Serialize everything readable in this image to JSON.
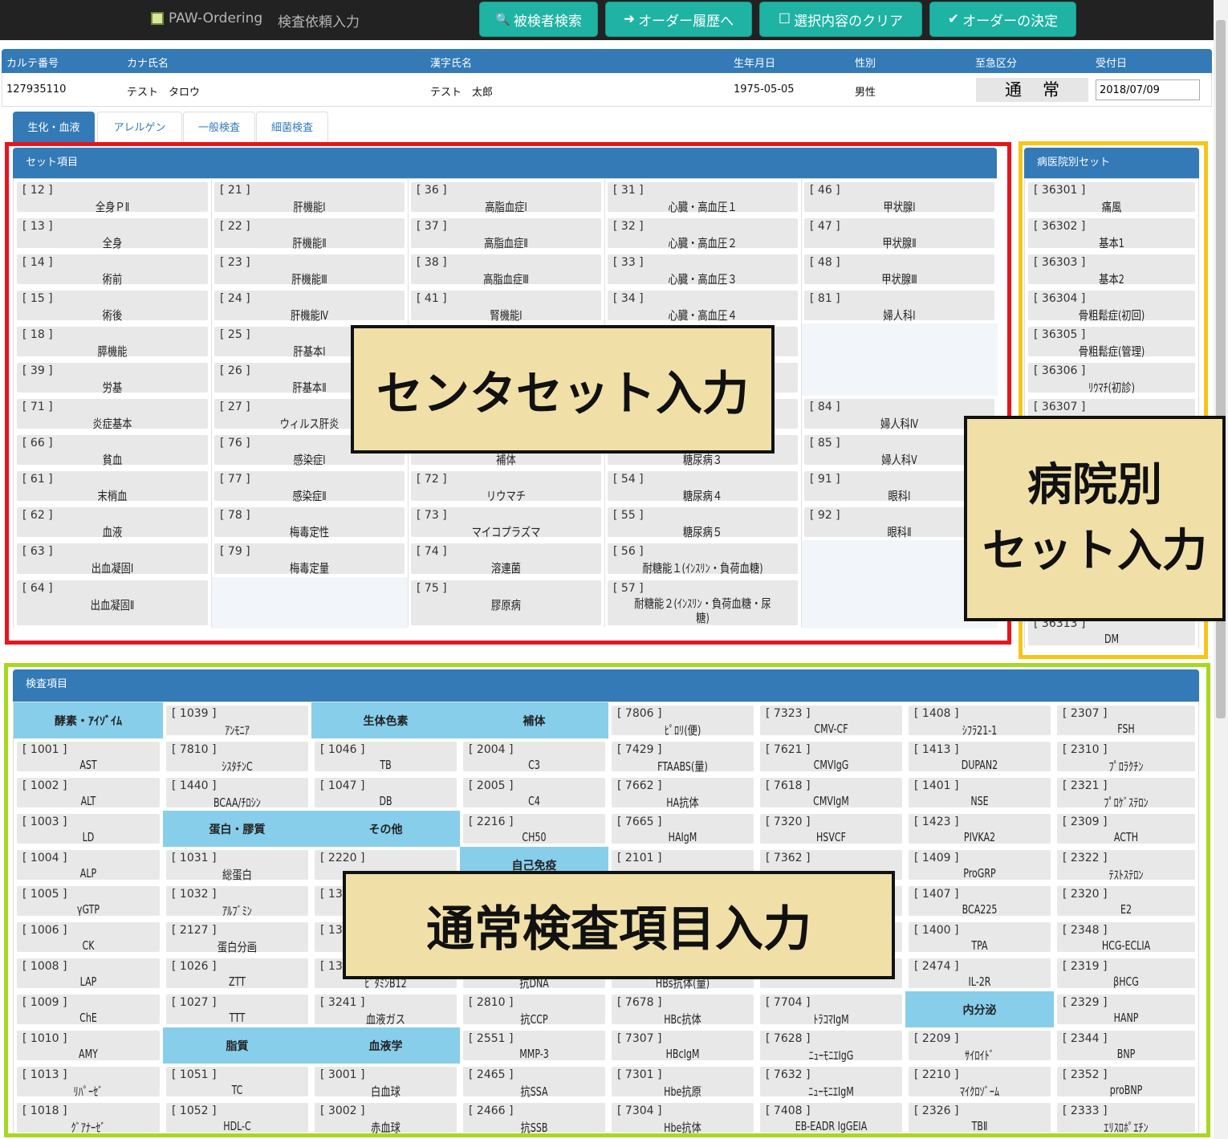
{
  "app": {
    "title": "PAW-Ordering",
    "subtitle": "検査依頼入力"
  },
  "toolbar": [
    {
      "icon": "search-icon",
      "label": "被検者検索",
      "glyph": "🔍"
    },
    {
      "icon": "arrow-right-icon",
      "label": "オーダー履歴へ",
      "glyph": "➜"
    },
    {
      "icon": "checkbox-empty-icon",
      "label": "選択内容のクリア",
      "glyph": "☐"
    },
    {
      "icon": "checkmark-icon",
      "label": "オーダーの決定",
      "glyph": "✔"
    }
  ],
  "patient": {
    "headers": [
      "カルテ番号",
      "カナ氏名",
      "漢字氏名",
      "生年月日",
      "性別",
      "至急区分",
      "受付日"
    ],
    "chart_no": "127935110",
    "kana": "テスト　タロウ",
    "kanji": "テスト　太郎",
    "birth": "1975-05-05",
    "sex": "男性",
    "urgency": "通常",
    "reception_date": "2018/07/09"
  },
  "tabs": [
    "生化・血液",
    "アレルゲン",
    "一般検査",
    "細菌検査"
  ],
  "center_set": {
    "title": "セット項目",
    "columns": [
      [
        [
          "[ 12 ]",
          "全身ＰⅡ"
        ],
        [
          "[ 13 ]",
          "全身"
        ],
        [
          "[ 14 ]",
          "術前"
        ],
        [
          "[ 15 ]",
          "術後"
        ],
        [
          "[ 18 ]",
          "膵機能"
        ],
        [
          "[ 39 ]",
          "労基"
        ],
        [
          "[ 71 ]",
          "炎症基本"
        ],
        [
          "[ 66 ]",
          "貧血"
        ],
        [
          "[ 61 ]",
          "末梢血"
        ],
        [
          "[ 62 ]",
          "血液"
        ],
        [
          "[ 63 ]",
          "出血凝固Ⅰ"
        ],
        [
          "[ 64 ]",
          "出血凝固Ⅱ"
        ]
      ],
      [
        [
          "[ 21 ]",
          "肝機能Ⅰ"
        ],
        [
          "[ 22 ]",
          "肝機能Ⅱ"
        ],
        [
          "[ 23 ]",
          "肝機能Ⅲ"
        ],
        [
          "[ 24 ]",
          "肝機能Ⅳ"
        ],
        [
          "[ 25 ]",
          "肝基本Ⅰ"
        ],
        [
          "[ 26 ]",
          "肝基本Ⅱ"
        ],
        [
          "[ 27 ]",
          "ウィルス肝炎"
        ],
        [
          "[ 76 ]",
          "感染症Ⅰ"
        ],
        [
          "[ 77 ]",
          "感染症Ⅱ"
        ],
        [
          "[ 78 ]",
          "梅毒定性"
        ],
        [
          "[ 79 ]",
          "梅毒定量"
        ],
        null
      ],
      [
        [
          "[ 36 ]",
          "高脂血症Ⅰ"
        ],
        [
          "[ 37 ]",
          "高脂血症Ⅱ"
        ],
        [
          "[ 38 ]",
          "高脂血症Ⅲ"
        ],
        [
          "[ 41 ]",
          "腎機能Ⅰ"
        ],
        [
          "",
          ""
        ],
        [
          "",
          ""
        ],
        [
          "",
          ""
        ],
        [
          "",
          "補体"
        ],
        [
          "[ 72 ]",
          "リウマチ"
        ],
        [
          "[ 73 ]",
          "マイコプラズマ"
        ],
        [
          "[ 74 ]",
          "溶連菌"
        ],
        [
          "[ 75 ]",
          "膠原病"
        ]
      ],
      [
        [
          "[ 31 ]",
          "心臓・高血圧１"
        ],
        [
          "[ 32 ]",
          "心臓・高血圧２"
        ],
        [
          "[ 33 ]",
          "心臓・高血圧３"
        ],
        [
          "[ 34 ]",
          "心臓・高血圧４"
        ],
        [
          "",
          ""
        ],
        [
          "",
          ""
        ],
        [
          "",
          ""
        ],
        [
          "",
          "糖尿病３"
        ],
        [
          "[ 54 ]",
          "糖尿病４"
        ],
        [
          "[ 55 ]",
          "糖尿病５"
        ],
        [
          "[ 56 ]",
          "耐糖能１(ｲﾝｽﾘﾝ・負荷血糖)"
        ],
        [
          "[ 57 ]",
          "耐糖能２(ｲﾝｽﾘﾝ・負荷血糖・尿糖)"
        ]
      ],
      [
        [
          "[ 46 ]",
          "甲状腺Ⅰ"
        ],
        [
          "[ 47 ]",
          "甲状腺Ⅱ"
        ],
        [
          "[ 48 ]",
          "甲状腺Ⅲ"
        ],
        [
          "[ 81 ]",
          "婦人科Ⅰ"
        ],
        null,
        null,
        [
          "[ 84 ]",
          "婦人科Ⅳ"
        ],
        [
          "[ 85 ]",
          "婦人科Ⅴ"
        ],
        [
          "[ 91 ]",
          "眼科Ⅰ"
        ],
        [
          "[ 92 ]",
          "眼科Ⅱ"
        ],
        null,
        null
      ]
    ]
  },
  "hospital_set": {
    "title": "病医院別セット",
    "items": [
      [
        "[ 36301 ]",
        "痛風"
      ],
      [
        "[ 36302 ]",
        "基本1"
      ],
      [
        "[ 36303 ]",
        "基本2"
      ],
      [
        "[ 36304 ]",
        "骨粗鬆症(初回)"
      ],
      [
        "[ 36305 ]",
        "骨粗鬆症(管理)"
      ],
      [
        "[ 36306 ]",
        "ﾘｳﾏﾁ(初診)"
      ],
      [
        "[ 36307 ]",
        ""
      ],
      [
        "",
        ""
      ],
      [
        "",
        ""
      ],
      [
        "",
        ""
      ],
      [
        "",
        ""
      ],
      [
        "",
        ""
      ],
      [
        "[ 36313 ]",
        "DM"
      ]
    ]
  },
  "test_items": {
    "title": "検査項目",
    "columns": [
      [
        {
          "h": "酵素・ｱｲｿﾞｲﾑ"
        },
        [
          "[ 1001 ]",
          "AST"
        ],
        [
          "[ 1002 ]",
          "ALT"
        ],
        [
          "[ 1003 ]",
          "LD"
        ],
        [
          "[ 1004 ]",
          "ALP"
        ],
        [
          "[ 1005 ]",
          "γGTP"
        ],
        [
          "[ 1006 ]",
          "CK"
        ],
        [
          "[ 1008 ]",
          "LAP"
        ],
        [
          "[ 1009 ]",
          "ChE"
        ],
        [
          "[ 1010 ]",
          "AMY"
        ],
        [
          "[ 1013 ]",
          "ﾘﾊﾟｰｾﾞ"
        ],
        [
          "[ 1018 ]",
          "ｸﾞｱﾅｰｾﾞ"
        ]
      ],
      [
        [
          "[ 1039 ]",
          "ｱﾝﾓﾆｱ"
        ],
        [
          "[ 7810 ]",
          "ｼｽﾀﾁﾝC"
        ],
        [
          "[ 1440 ]",
          "BCAA/ﾁﾛｼﾝ"
        ],
        {
          "h": "蛋白・膠質"
        },
        [
          "[ 1031 ]",
          "総蛋白"
        ],
        [
          "[ 1032 ]",
          "ｱﾙﾌﾞﾐﾝ"
        ],
        [
          "[ 2127 ]",
          "蛋白分画"
        ],
        [
          "[ 1026 ]",
          "ZTT"
        ],
        [
          "[ 1027 ]",
          "TTT"
        ],
        {
          "h": "脂質"
        },
        [
          "[ 1051 ]",
          "TC"
        ],
        [
          "[ 1052 ]",
          "HDL-C"
        ]
      ],
      [
        {
          "h": "生体色素"
        },
        [
          "[ 1046 ]",
          "TB"
        ],
        [
          "[ 1047 ]",
          "DB"
        ],
        {
          "h": "その他"
        },
        [
          "[ 2220 ]",
          ""
        ],
        [
          "[ 13",
          ""
        ],
        [
          "[ 13",
          ""
        ],
        [
          "[ 13",
          "ﾋﾞﾀﾐﾝB12"
        ],
        [
          "[ 3241 ]",
          "血液ガス"
        ],
        {
          "h": "血液学"
        },
        [
          "[ 3001 ]",
          "白血球"
        ],
        [
          "[ 3002 ]",
          "赤血球"
        ]
      ],
      [
        {
          "h": "補体"
        },
        [
          "[ 2004 ]",
          "C3"
        ],
        [
          "[ 2005 ]",
          "C4"
        ],
        [
          "[ 2216 ]",
          "CH50"
        ],
        {
          "h": "自己免疫"
        },
        [
          "",
          ""
        ],
        [
          "",
          ""
        ],
        [
          "",
          "抗DNA"
        ],
        [
          "[ 2810 ]",
          "抗CCP"
        ],
        [
          "[ 2551 ]",
          "MMP-3"
        ],
        [
          "[ 2465 ]",
          "抗SSA"
        ],
        [
          "[ 2466 ]",
          "抗SSB"
        ]
      ],
      [
        [
          "[ 7806 ]",
          "ﾋﾟﾛﾘ(便)"
        ],
        [
          "[ 7429 ]",
          "FTAABS(量)"
        ],
        [
          "[ 7662 ]",
          "HA抗体"
        ],
        [
          "[ 7665 ]",
          "HAIgM"
        ],
        [
          "[ 2101 ]",
          ""
        ],
        [
          "",
          ""
        ],
        [
          "",
          ""
        ],
        [
          "",
          "HBs抗体(量)"
        ],
        [
          "[ 7678 ]",
          "HBc抗体"
        ],
        [
          "[ 7307 ]",
          "HBcIgM"
        ],
        [
          "[ 7301 ]",
          "Hbe抗原"
        ],
        [
          "[ 7304 ]",
          "Hbe抗体"
        ]
      ],
      [
        [
          "[ 7323 ]",
          "CMV-CF"
        ],
        [
          "[ 7621 ]",
          "CMVIgG"
        ],
        [
          "[ 7618 ]",
          "CMVIgM"
        ],
        [
          "[ 7320 ]",
          "HSVCF"
        ],
        [
          "[ 7362 ]",
          ""
        ],
        [
          "",
          ""
        ],
        [
          "",
          ""
        ],
        [
          "",
          ""
        ],
        [
          "[ 7704 ]",
          "ﾄﾗｺﾏIgM"
        ],
        [
          "[ 7628 ]",
          "ﾆｭｰﾓﾆｴIgG"
        ],
        [
          "[ 7632 ]",
          "ﾆｭｰﾓﾆｴIgM"
        ],
        [
          "[ 7408 ]",
          "EB-EADR IgGEIA"
        ]
      ],
      [
        [
          "[ 1408 ]",
          "ｼﾌﾗ21-1"
        ],
        [
          "[ 1413 ]",
          "DUPAN2"
        ],
        [
          "[ 1401 ]",
          "NSE"
        ],
        [
          "[ 1423 ]",
          "PIVKA2"
        ],
        [
          "[ 1409 ]",
          "ProGRP"
        ],
        [
          "[ 1407 ]",
          "BCA225"
        ],
        [
          "[ 1400 ]",
          "TPA"
        ],
        [
          "[ 2474 ]",
          "IL-2R"
        ],
        {
          "h": "内分泌"
        },
        [
          "[ 2209 ]",
          "ｻｲﾛｲﾄﾞ"
        ],
        [
          "[ 2210 ]",
          "ﾏｲｸﾛｿﾞｰﾑ"
        ],
        [
          "[ 2326 ]",
          "TBⅡ"
        ]
      ],
      [
        [
          "[ 2307 ]",
          "FSH"
        ],
        [
          "[ 2310 ]",
          "ﾌﾟﾛﾗｸﾁﾝ"
        ],
        [
          "[ 2321 ]",
          "ﾌﾟﾛｹﾞｽﾃﾛﾝ"
        ],
        [
          "[ 2309 ]",
          "ACTH"
        ],
        [
          "[ 2322 ]",
          "ﾃｽﾄｽﾃﾛﾝ"
        ],
        [
          "[ 2320 ]",
          "E2"
        ],
        [
          "[ 2348 ]",
          "HCG-ECLIA"
        ],
        [
          "[ 2319 ]",
          "βHCG"
        ],
        [
          "[ 2329 ]",
          "HANP"
        ],
        [
          "[ 2344 ]",
          "BNP"
        ],
        [
          "[ 2352 ]",
          "proBNP"
        ],
        [
          "[ 2333 ]",
          "ｴﾘｽﾛﾎﾟｴﾁﾝ"
        ]
      ]
    ]
  },
  "callouts": {
    "center": "センタセット入力",
    "hospital_line1": "病院別",
    "hospital_line2": "セット入力",
    "tests": "通常検査項目入力"
  },
  "colors": {
    "topbar": "#222222",
    "accent": "#337ab7",
    "button": "#1fb3a3",
    "group_header": "#87ceeb",
    "frame_red": "#e8141e",
    "frame_yellow": "#f5c518",
    "frame_green": "#a8d81e",
    "callout_fill": "#f0e0a8"
  }
}
